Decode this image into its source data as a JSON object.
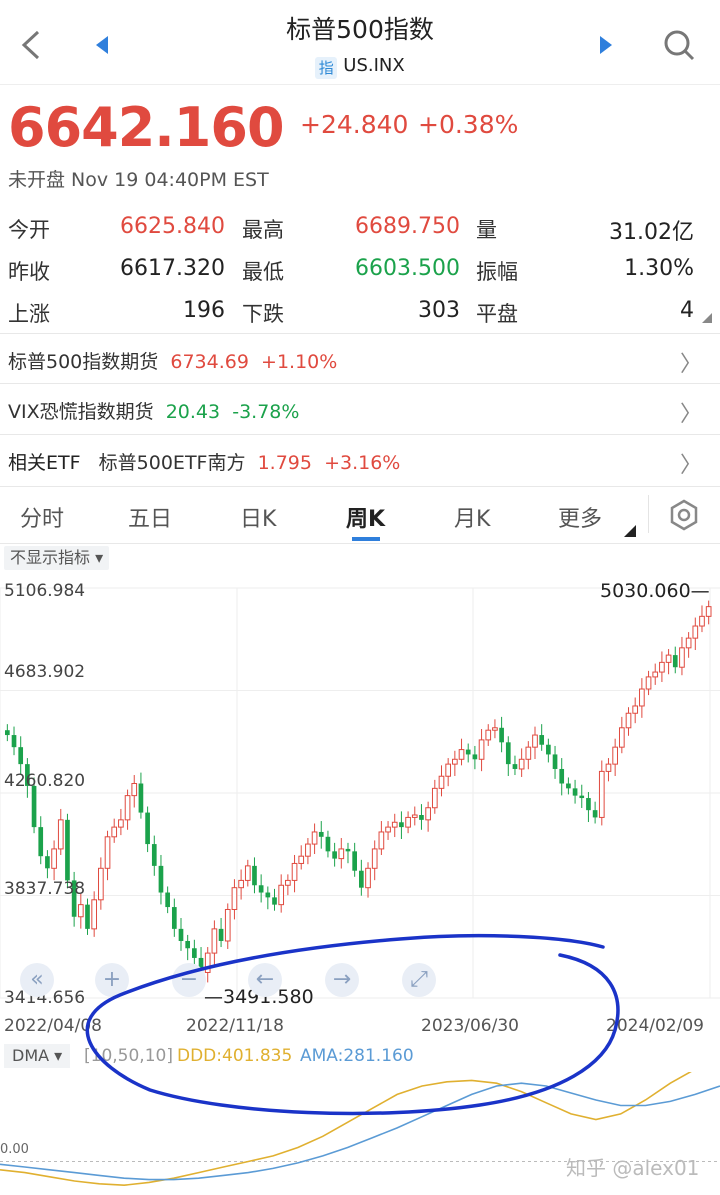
{
  "header": {
    "title": "标普500指数",
    "tag": "指",
    "symbol": "US.INX",
    "back_icon": "chevron-left-icon",
    "prev_icon": "triangle-left-icon",
    "next_icon": "triangle-right-icon",
    "search_icon": "search-icon"
  },
  "quote": {
    "price": "6642.160",
    "change": "+24.840",
    "change_pct": "+0.38%",
    "session": "未开盘 Nov 19 04:40PM EST"
  },
  "stats": {
    "open_label": "今开",
    "open": "6625.840",
    "high_label": "最高",
    "high": "6689.750",
    "volume_label": "量",
    "volume": "31.02亿",
    "prev_close_label": "昨收",
    "prev_close": "6617.320",
    "low_label": "最低",
    "low": "6603.500",
    "amplitude_label": "振幅",
    "amplitude": "1.30%",
    "up_label": "上涨",
    "up": "196",
    "down_label": "下跌",
    "down": "303",
    "flat_label": "平盘",
    "flat": "4"
  },
  "links": {
    "futures_label": "标普500指数期货",
    "futures_value": "6734.69",
    "futures_pct": "+1.10%",
    "vix_label": "VIX恐慌指数期货",
    "vix_value": "20.43",
    "vix_pct": "-3.78%",
    "etf_label": "相关ETF",
    "etf_name": "标普500ETF南方",
    "etf_value": "1.795",
    "etf_pct": "+3.16%"
  },
  "tabs": [
    "分时",
    "五日",
    "日K",
    "周K",
    "月K",
    "更多"
  ],
  "active_tab": "周K",
  "settings_icon": "hexagon-gear-icon",
  "indicator_toggle": "不显示指标 ▾",
  "chart": {
    "y_labels": [
      "5106.984",
      "4683.902",
      "4260.820",
      "3837.738",
      "3414.656"
    ],
    "x_labels": [
      "2022/04/08",
      "2022/11/18",
      "2023/06/30",
      "2024/02/09"
    ],
    "max_label": "5030.060",
    "min_label": "3491.580",
    "controls": [
      "«",
      "+",
      "−",
      "←",
      "→",
      "⤢"
    ]
  },
  "dma": {
    "selector": "DMA ▾",
    "params": "[10,50,10]",
    "ddd": "DDD:401.835",
    "ama": "AMA:281.160",
    "zero_label": "0.00"
  },
  "watermark": "知乎 @alex01",
  "colors": {
    "up": "#e04a3f",
    "down": "#1ba24b",
    "ddd": "#e0b030",
    "ama": "#5b9bd5",
    "annotation": "#1a33c8"
  },
  "chart_data": {
    "type": "candlestick",
    "title": "",
    "ylim": [
      3414.656,
      5106.984
    ],
    "y_ticks": [
      5106.984,
      4683.902,
      4260.82,
      3837.738,
      3414.656
    ],
    "x_ticks": [
      "2022/04/08",
      "2022/11/18",
      "2023/06/30",
      "2024/02/09"
    ],
    "close_series": [
      4500,
      4450,
      4380,
      4290,
      4120,
      4000,
      3950,
      4030,
      4150,
      3900,
      3750,
      3800,
      3700,
      3820,
      3950,
      4080,
      4120,
      4150,
      4250,
      4300,
      4180,
      4050,
      3960,
      3850,
      3790,
      3700,
      3650,
      3620,
      3580,
      3520,
      3600,
      3700,
      3650,
      3780,
      3870,
      3900,
      3960,
      3880,
      3850,
      3830,
      3800,
      3880,
      3900,
      3970,
      4000,
      4050,
      4100,
      4080,
      4020,
      3990,
      4030,
      4020,
      3940,
      3870,
      3950,
      4030,
      4100,
      4120,
      4140,
      4120,
      4160,
      4170,
      4150,
      4200,
      4280,
      4330,
      4380,
      4400,
      4440,
      4420,
      4400,
      4480,
      4520,
      4530,
      4470,
      4380,
      4360,
      4400,
      4450,
      4500,
      4460,
      4420,
      4360,
      4300,
      4280,
      4250,
      4240,
      4190,
      4160,
      4350,
      4380,
      4450,
      4530,
      4590,
      4620,
      4690,
      4740,
      4760,
      4800,
      4830,
      4780,
      4860,
      4900,
      4950,
      4990,
      5030
    ],
    "max": 5030.06,
    "min": 3491.58
  },
  "dma_data": {
    "ddd": [
      -30,
      -40,
      -55,
      -70,
      -80,
      -85,
      -75,
      -60,
      -40,
      -20,
      0,
      20,
      50,
      90,
      140,
      190,
      240,
      270,
      285,
      290,
      280,
      250,
      210,
      170,
      150,
      170,
      220,
      280,
      330,
      380
    ],
    "ama": [
      -10,
      -20,
      -30,
      -40,
      -50,
      -60,
      -65,
      -65,
      -60,
      -50,
      -40,
      -25,
      -5,
      20,
      50,
      85,
      120,
      160,
      200,
      240,
      270,
      280,
      270,
      245,
      220,
      200,
      200,
      215,
      240,
      270
    ]
  }
}
